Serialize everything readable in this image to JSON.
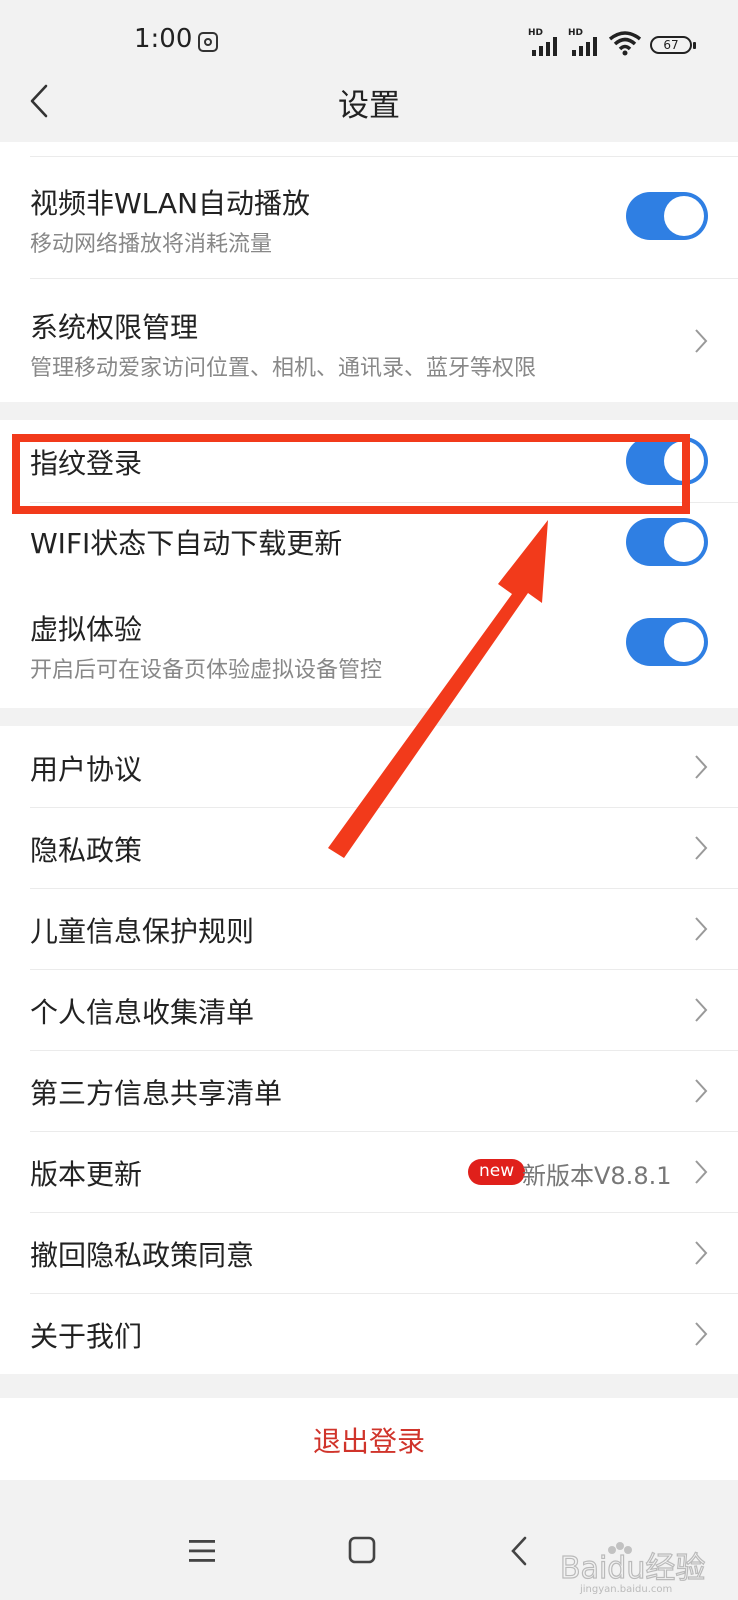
{
  "status_bar": {
    "time": "1:00",
    "signal1_label": "HD",
    "signal2_label": "HD",
    "battery": "67"
  },
  "header": {
    "title": "设置"
  },
  "toggle_rows": [
    {
      "title": "视频非WLAN自动播放",
      "subtitle": "移动网络播放将消耗流量",
      "enabled": true
    },
    {
      "title": "系统权限管理",
      "subtitle": "管理移动爱家访问位置、相机、通讯录、蓝牙等权限"
    },
    {
      "title": "指纹登录",
      "enabled": true
    },
    {
      "title": "WIFI状态下自动下载更新",
      "enabled": true
    },
    {
      "title": "虚拟体验",
      "subtitle": "开启后可在设备页体验虚拟设备管控",
      "enabled": true
    }
  ],
  "menu_items": [
    {
      "label": "用户协议"
    },
    {
      "label": "隐私政策"
    },
    {
      "label": "儿童信息保护规则"
    },
    {
      "label": "个人信息收集清单"
    },
    {
      "label": "第三方信息共享清单"
    },
    {
      "label": "版本更新",
      "badge": "new",
      "value": "新版本V8.8.1"
    },
    {
      "label": "撤回隐私政策同意"
    },
    {
      "label": "关于我们"
    }
  ],
  "logout_label": "退出登录",
  "watermark_text": "Baidu经验",
  "watermark_url": "jingyan.baidu.com",
  "colors": {
    "toggle_on": "#2f7fe3",
    "annotation": "#f23a1b",
    "logout": "#d0342b",
    "badge": "#e0201b"
  }
}
